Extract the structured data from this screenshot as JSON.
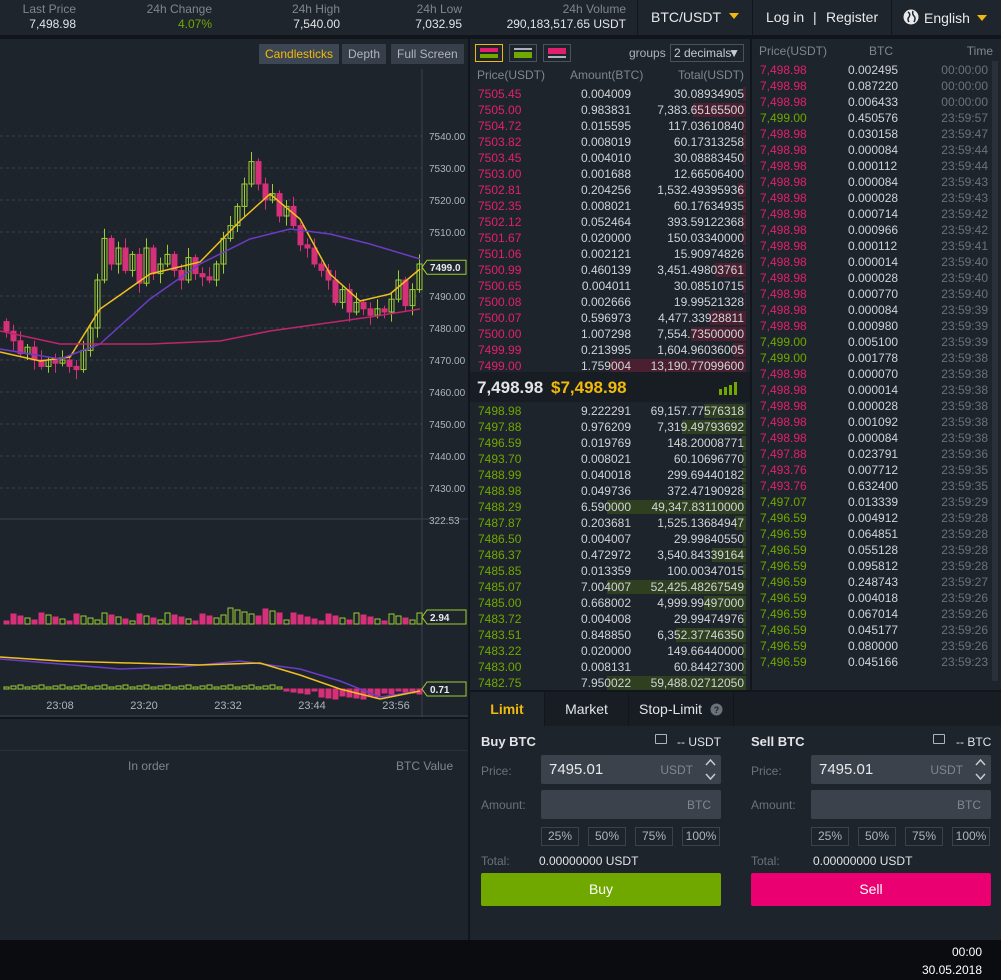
{
  "header": {
    "stats": [
      {
        "label": "Last Price",
        "value": "7,498.98",
        "color": "default"
      },
      {
        "label": "24h Change",
        "value": "4.07%",
        "color": "green"
      },
      {
        "label": "24h High",
        "value": "7,540.00",
        "color": "default"
      },
      {
        "label": "24h Low",
        "value": "7,032.95",
        "color": "default"
      },
      {
        "label": "24h Volume",
        "value": "290,183,517.65 USDT",
        "color": "default"
      }
    ],
    "pair": "BTC/USDT",
    "login": "Log in",
    "separator": "|",
    "register": "Register",
    "language": "English"
  },
  "chart": {
    "buttons": [
      "Candlesticks",
      "Depth",
      "Full Screen"
    ],
    "active_button": "Candlesticks",
    "price_ticks": [
      "7540.00",
      "7530.00",
      "7520.00",
      "7510.00",
      "7490.00",
      "7480.00",
      "7470.00",
      "7460.00",
      "7450.00",
      "7440.00",
      "7430.00"
    ],
    "current_price_tag": "7499.0",
    "volume_label": "322.53",
    "volume_tag": "2.94",
    "macd_tag": "0.71",
    "time_ticks": [
      "23:08",
      "23:20",
      "23:32",
      "23:44",
      "23:56"
    ]
  },
  "balances": {
    "col_in_order": "In order",
    "col_btc_value": "BTC Value"
  },
  "orderbook": {
    "groups_label": "groups",
    "groups_value": "2 decimals",
    "headers": [
      "Price(USDT)",
      "Amount(BTC)",
      "Total(USDT)"
    ],
    "asks": [
      {
        "price": "7505.45",
        "amount": "0.004009",
        "total": "30.08934905",
        "depth": 0.02
      },
      {
        "price": "7505.00",
        "amount": "0.983831",
        "total": "7,383.65165500",
        "depth": 0.38
      },
      {
        "price": "7504.72",
        "amount": "0.015595",
        "total": "117.03610840",
        "depth": 0.02
      },
      {
        "price": "7503.82",
        "amount": "0.008019",
        "total": "60.17313258",
        "depth": 0.02
      },
      {
        "price": "7503.45",
        "amount": "0.004010",
        "total": "30.08883450",
        "depth": 0.02
      },
      {
        "price": "7503.00",
        "amount": "0.001688",
        "total": "12.66506400",
        "depth": 0.01
      },
      {
        "price": "7502.81",
        "amount": "0.204256",
        "total": "1,532.49395936",
        "depth": 0.06
      },
      {
        "price": "7502.35",
        "amount": "0.008021",
        "total": "60.17634935",
        "depth": 0.02
      },
      {
        "price": "7502.12",
        "amount": "0.052464",
        "total": "393.59122368",
        "depth": 0.03
      },
      {
        "price": "7501.67",
        "amount": "0.020000",
        "total": "150.03340000",
        "depth": 0.02
      },
      {
        "price": "7501.06",
        "amount": "0.002121",
        "total": "15.90974826",
        "depth": 0.01
      },
      {
        "price": "7500.99",
        "amount": "0.460139",
        "total": "3,451.49803761",
        "depth": 0.22
      },
      {
        "price": "7500.65",
        "amount": "0.004011",
        "total": "30.08510715",
        "depth": 0.02
      },
      {
        "price": "7500.08",
        "amount": "0.002666",
        "total": "19.99521328",
        "depth": 0.01
      },
      {
        "price": "7500.07",
        "amount": "0.596973",
        "total": "4,477.33928811",
        "depth": 0.26
      },
      {
        "price": "7500.00",
        "amount": "1.007298",
        "total": "7,554.73500000",
        "depth": 0.39
      },
      {
        "price": "7499.99",
        "amount": "0.213995",
        "total": "1,604.96036005",
        "depth": 0.09
      },
      {
        "price": "7499.00",
        "amount": "1.759004",
        "total": "13,190.77099600",
        "depth": 0.97
      }
    ],
    "last_price": "7,498.98",
    "last_price_usd": "$7,498.98",
    "bids": [
      {
        "price": "7498.98",
        "amount": "9.222291",
        "total": "69,157.77576318",
        "depth": 0.3
      },
      {
        "price": "7497.88",
        "amount": "0.976209",
        "total": "7,319.49793692",
        "depth": 0.46
      },
      {
        "price": "7496.59",
        "amount": "0.019769",
        "total": "148.20008771",
        "depth": 0.03
      },
      {
        "price": "7493.70",
        "amount": "0.008021",
        "total": "60.10696770",
        "depth": 0.02
      },
      {
        "price": "7488.99",
        "amount": "0.040018",
        "total": "299.69440182",
        "depth": 0.03
      },
      {
        "price": "7488.98",
        "amount": "0.049736",
        "total": "372.47190928",
        "depth": 0.03
      },
      {
        "price": "7488.29",
        "amount": "6.590000",
        "total": "49,347.83110000",
        "depth": 0.99
      },
      {
        "price": "7487.87",
        "amount": "0.203681",
        "total": "1,525.13684947",
        "depth": 0.08
      },
      {
        "price": "7486.50",
        "amount": "0.004007",
        "total": "29.99840550",
        "depth": 0.02
      },
      {
        "price": "7486.37",
        "amount": "0.472972",
        "total": "3,540.84339164",
        "depth": 0.24
      },
      {
        "price": "7485.85",
        "amount": "0.013359",
        "total": "100.00347015",
        "depth": 0.02
      },
      {
        "price": "7485.07",
        "amount": "7.004007",
        "total": "52,425.48267549",
        "depth": 0.99
      },
      {
        "price": "7485.00",
        "amount": "0.668002",
        "total": "4,999.99497000",
        "depth": 0.3
      },
      {
        "price": "7483.72",
        "amount": "0.004008",
        "total": "29.99474976",
        "depth": 0.02
      },
      {
        "price": "7483.51",
        "amount": "0.848850",
        "total": "6,352.37746350",
        "depth": 0.5
      },
      {
        "price": "7483.22",
        "amount": "0.020000",
        "total": "149.66440000",
        "depth": 0.02
      },
      {
        "price": "7483.00",
        "amount": "0.008131",
        "total": "60.84427300",
        "depth": 0.02
      },
      {
        "price": "7482.75",
        "amount": "7.950022",
        "total": "59,488.02712050",
        "depth": 0.99
      }
    ]
  },
  "trades": {
    "headers": [
      "Price(USDT)",
      "BTC",
      "Time"
    ],
    "rows": [
      {
        "price": "7,498.98",
        "amount": "0.002495",
        "time": "00:00:00",
        "dir": "down"
      },
      {
        "price": "7,498.98",
        "amount": "0.087220",
        "time": "00:00:00",
        "dir": "down"
      },
      {
        "price": "7,498.98",
        "amount": "0.006433",
        "time": "00:00:00",
        "dir": "down"
      },
      {
        "price": "7,499.00",
        "amount": "0.450576",
        "time": "23:59:57",
        "dir": "up"
      },
      {
        "price": "7,498.98",
        "amount": "0.030158",
        "time": "23:59:47",
        "dir": "down"
      },
      {
        "price": "7,498.98",
        "amount": "0.000084",
        "time": "23:59:44",
        "dir": "down"
      },
      {
        "price": "7,498.98",
        "amount": "0.000112",
        "time": "23:59:44",
        "dir": "down"
      },
      {
        "price": "7,498.98",
        "amount": "0.000084",
        "time": "23:59:43",
        "dir": "down"
      },
      {
        "price": "7,498.98",
        "amount": "0.000028",
        "time": "23:59:43",
        "dir": "down"
      },
      {
        "price": "7,498.98",
        "amount": "0.000714",
        "time": "23:59:42",
        "dir": "down"
      },
      {
        "price": "7,498.98",
        "amount": "0.000966",
        "time": "23:59:42",
        "dir": "down"
      },
      {
        "price": "7,498.98",
        "amount": "0.000112",
        "time": "23:59:41",
        "dir": "down"
      },
      {
        "price": "7,498.98",
        "amount": "0.000014",
        "time": "23:59:40",
        "dir": "down"
      },
      {
        "price": "7,498.98",
        "amount": "0.000028",
        "time": "23:59:40",
        "dir": "down"
      },
      {
        "price": "7,498.98",
        "amount": "0.000770",
        "time": "23:59:40",
        "dir": "down"
      },
      {
        "price": "7,498.98",
        "amount": "0.000084",
        "time": "23:59:39",
        "dir": "down"
      },
      {
        "price": "7,498.98",
        "amount": "0.000980",
        "time": "23:59:39",
        "dir": "down"
      },
      {
        "price": "7,499.00",
        "amount": "0.005100",
        "time": "23:59:39",
        "dir": "up"
      },
      {
        "price": "7,499.00",
        "amount": "0.001778",
        "time": "23:59:38",
        "dir": "up"
      },
      {
        "price": "7,498.98",
        "amount": "0.000070",
        "time": "23:59:38",
        "dir": "down"
      },
      {
        "price": "7,498.98",
        "amount": "0.000014",
        "time": "23:59:38",
        "dir": "down"
      },
      {
        "price": "7,498.98",
        "amount": "0.000028",
        "time": "23:59:38",
        "dir": "down"
      },
      {
        "price": "7,498.98",
        "amount": "0.001092",
        "time": "23:59:38",
        "dir": "down"
      },
      {
        "price": "7,498.98",
        "amount": "0.000084",
        "time": "23:59:38",
        "dir": "down"
      },
      {
        "price": "7,497.88",
        "amount": "0.023791",
        "time": "23:59:36",
        "dir": "down"
      },
      {
        "price": "7,493.76",
        "amount": "0.007712",
        "time": "23:59:35",
        "dir": "down"
      },
      {
        "price": "7,493.76",
        "amount": "0.632400",
        "time": "23:59:35",
        "dir": "down"
      },
      {
        "price": "7,497.07",
        "amount": "0.013339",
        "time": "23:59:29",
        "dir": "up"
      },
      {
        "price": "7,496.59",
        "amount": "0.004912",
        "time": "23:59:28",
        "dir": "up"
      },
      {
        "price": "7,496.59",
        "amount": "0.064851",
        "time": "23:59:28",
        "dir": "up"
      },
      {
        "price": "7,496.59",
        "amount": "0.055128",
        "time": "23:59:28",
        "dir": "up"
      },
      {
        "price": "7,496.59",
        "amount": "0.095812",
        "time": "23:59:28",
        "dir": "up"
      },
      {
        "price": "7,496.59",
        "amount": "0.248743",
        "time": "23:59:27",
        "dir": "up"
      },
      {
        "price": "7,496.59",
        "amount": "0.004018",
        "time": "23:59:26",
        "dir": "up"
      },
      {
        "price": "7,496.59",
        "amount": "0.067014",
        "time": "23:59:26",
        "dir": "up"
      },
      {
        "price": "7,496.59",
        "amount": "0.045177",
        "time": "23:59:26",
        "dir": "up"
      },
      {
        "price": "7,496.59",
        "amount": "0.080000",
        "time": "23:59:26",
        "dir": "up"
      },
      {
        "price": "7,496.59",
        "amount": "0.045166",
        "time": "23:59:23",
        "dir": "up"
      }
    ]
  },
  "form": {
    "tabs": [
      "Limit",
      "Market",
      "Stop-Limit"
    ],
    "active_tab": "Limit",
    "buy": {
      "title": "Buy BTC",
      "balance": "-- USDT",
      "price_label": "Price:",
      "price_value": "7495.01",
      "price_unit": "USDT",
      "amount_label": "Amount:",
      "amount_unit": "BTC",
      "percents": [
        "25%",
        "50%",
        "75%",
        "100%"
      ],
      "total_label": "Total:",
      "total_value": "0.00000000 USDT",
      "button": "Buy"
    },
    "sell": {
      "title": "Sell BTC",
      "balance": "-- BTC",
      "price_label": "Price:",
      "price_value": "7495.01",
      "price_unit": "USDT",
      "amount_label": "Amount:",
      "amount_unit": "BTC",
      "percents": [
        "25%",
        "50%",
        "75%",
        "100%"
      ],
      "total_label": "Total:",
      "total_value": "0.00000000 USDT",
      "button": "Sell"
    }
  },
  "taskbar": {
    "time": "00:00",
    "date": "30.05.2018"
  },
  "colors": {
    "accent": "#f0b90b",
    "buy": "#70a800",
    "sell": "#ea0070",
    "ask_text": "#e0206f",
    "bid_text": "#70a800"
  }
}
